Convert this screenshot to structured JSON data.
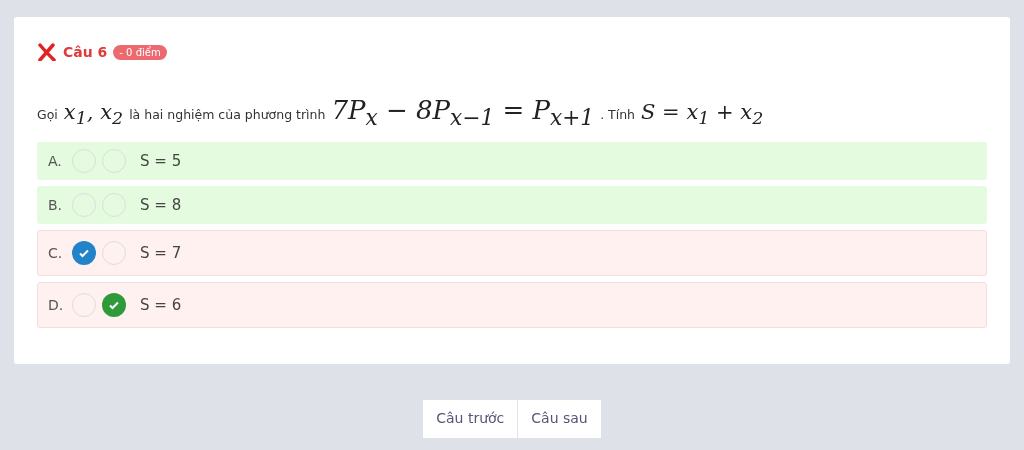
{
  "question": {
    "title": "Câu 6",
    "wrong": true,
    "score_badge": "- 0 điểm",
    "parts": [
      {
        "kind": "text",
        "text": "Gọi"
      },
      {
        "kind": "math",
        "text": "x$_{1}$, x$_{2}$"
      },
      {
        "kind": "text",
        "text": "là hai nghiệm của phương trình"
      },
      {
        "kind": "bigmath",
        "text": "7P$_{x}$ − 8P$_{x−1}$ = P$_{x+1}$"
      },
      {
        "kind": "text",
        "text": ". Tính"
      },
      {
        "kind": "math",
        "text": "S = x$_{1}$ + x$_{2}$"
      }
    ]
  },
  "options": [
    {
      "label": "A.",
      "text": "S = 5",
      "color": "#e5fbdf",
      "selected": false,
      "correct": false
    },
    {
      "label": "B.",
      "text": "S = 8",
      "color": "#e5fbdf",
      "selected": false,
      "correct": false
    },
    {
      "label": "C.",
      "text": "S = 7",
      "color": "#fff1f0",
      "selected": true,
      "correct": false
    },
    {
      "label": "D.",
      "text": "S = 6",
      "color": "#fff1f0",
      "selected": false,
      "correct": true
    }
  ],
  "nav": [
    "Câu trước",
    "Câu sau"
  ]
}
